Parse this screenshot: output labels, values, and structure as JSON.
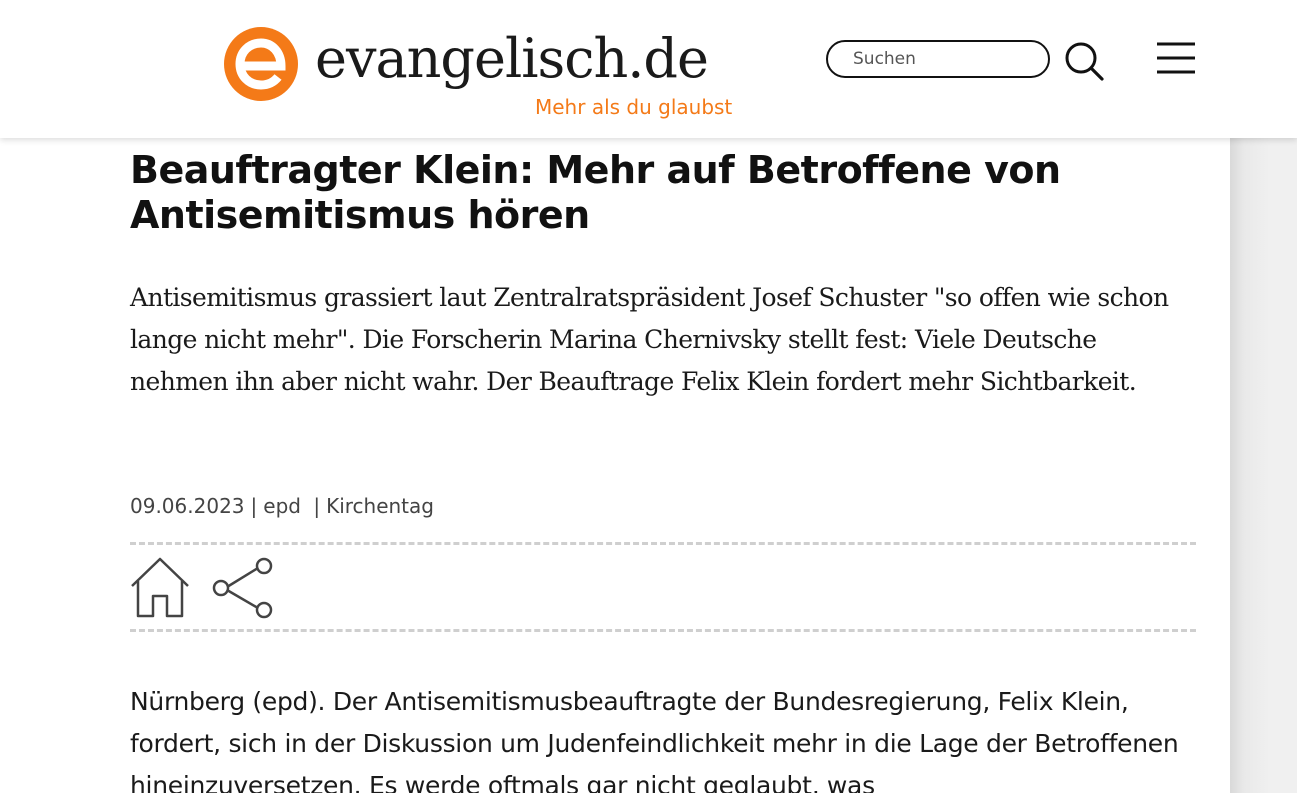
{
  "header": {
    "logo_text": "evangelisch.de",
    "tagline": "Mehr als du glaubst",
    "search_placeholder": "Suchen",
    "brand_color": "#f47a18"
  },
  "article": {
    "headline": "Beauftragter Klein: Mehr auf Betroffene von Antisemitismus hören",
    "lead": "Antisemitismus grassiert laut Zentralratspräsident Josef Schuster \"so offen wie schon lange nicht mehr\". Die Forscherin Marina Chernivsky stellt fest: Viele Deutsche nehmen ihn aber nicht wahr. Der Beauftrage Felix Klein fordert mehr Sichtbarkeit.",
    "meta": {
      "date": "09.06.2023",
      "source": "epd",
      "category": "Kirchentag"
    },
    "body": "Nürnberg (epd). Der Antisemitismusbeauftragte der Bundesregierung, Felix Klein, fordert, sich in der Diskussion um Judenfeindlichkeit mehr in die Lage der Betroffenen hineinzuversetzen. Es werde oftmals gar nicht geglaubt, was"
  },
  "icons": {
    "logo": "evangelisch-e-logo-icon",
    "search": "search-icon",
    "menu": "hamburger-menu-icon",
    "home": "home-icon",
    "share": "share-icon"
  }
}
